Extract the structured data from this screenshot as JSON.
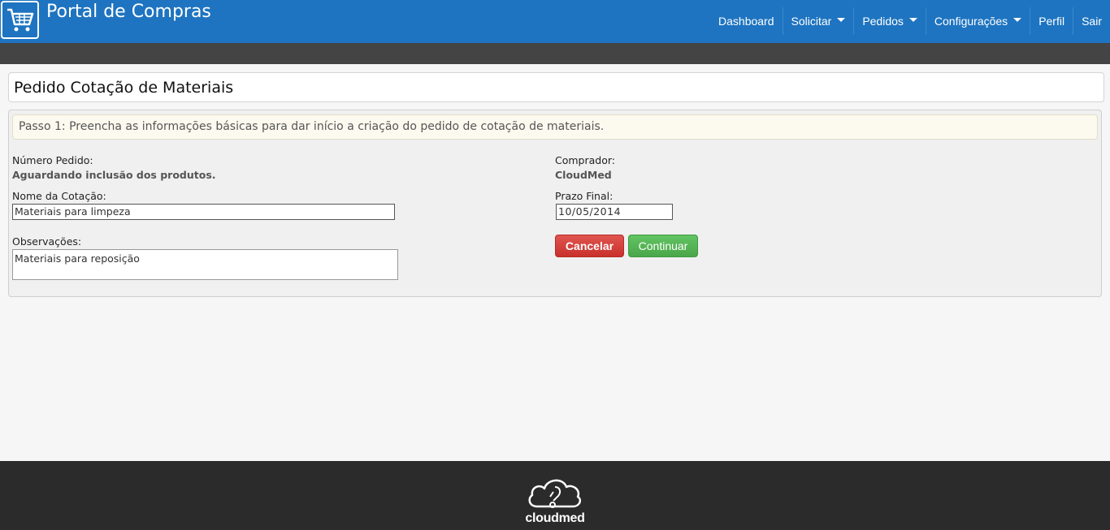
{
  "header": {
    "app_title": "Portal de Compras",
    "logo_icon": "shopping-cart-icon",
    "nav": [
      {
        "label": "Dashboard",
        "dropdown": false
      },
      {
        "label": "Solicitar",
        "dropdown": true
      },
      {
        "label": "Pedidos",
        "dropdown": true
      },
      {
        "label": "Configurações",
        "dropdown": true
      },
      {
        "label": "Perfil",
        "dropdown": false
      },
      {
        "label": "Sair",
        "dropdown": false
      }
    ],
    "color": "#1e74c0"
  },
  "page": {
    "title": "Pedido Cotação de Materiais"
  },
  "form": {
    "step_text": "Passo 1: Preencha as informações básicas para dar início a criação do pedido de cotação de materiais.",
    "numero_pedido_label": "Número Pedido:",
    "numero_pedido_value": "Aguardando inclusão dos produtos.",
    "nome_cotacao_label": "Nome da Cotação:",
    "nome_cotacao_value": "Materiais para limpeza",
    "observacoes_label": "Observações:",
    "observacoes_value": "Materiais para reposição",
    "comprador_label": "Comprador:",
    "comprador_value": "CloudMed",
    "prazo_final_label": "Prazo Final:",
    "prazo_final_value": "10/05/2014",
    "cancel_label": "Cancelar",
    "continue_label": "Continuar"
  },
  "footer": {
    "logo_text": "cloudmed",
    "logo_icon": "cloud-stethoscope-icon"
  }
}
